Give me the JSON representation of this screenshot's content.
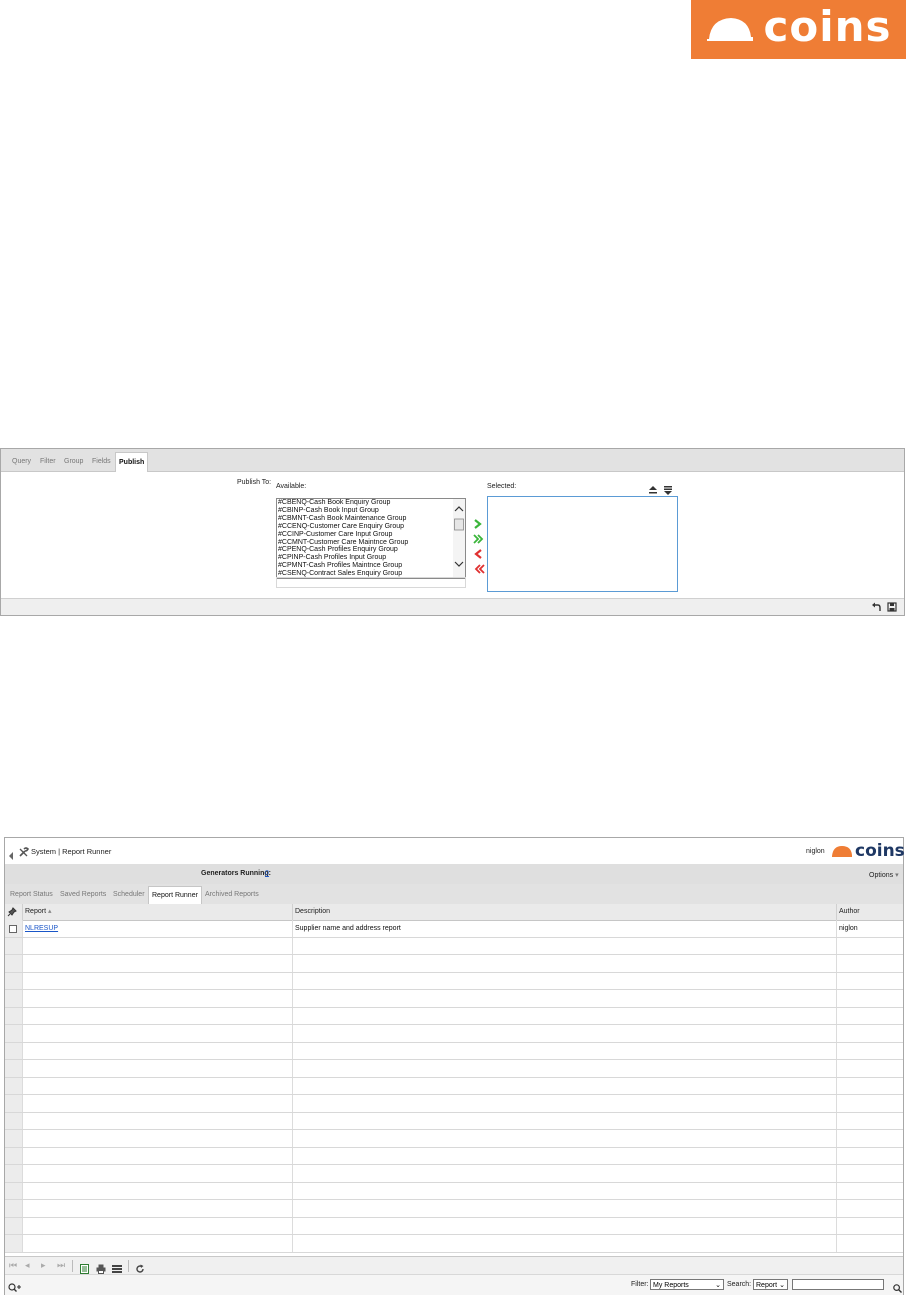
{
  "logo_top": {
    "brand": "coins"
  },
  "publish": {
    "tabs": [
      "Query",
      "Filter",
      "Group",
      "Fields",
      "Publish"
    ],
    "active_tab": "Publish",
    "publish_to_label": "Publish To:",
    "available_label": "Available:",
    "selected_label": "Selected:",
    "available_items": [
      "#CBENQ-Cash Book Enquiry Group",
      "#CBINP-Cash Book Input Group",
      "#CBMNT-Cash Book Maintenance Group",
      "#CCENQ-Customer Care Enquiry Group",
      "#CCINP-Customer Care Input Group",
      "#CCMNT-Customer Care Maintnce Group",
      "#CPENQ-Cash Profiles Enquiry Group",
      "#CPINP-Cash Profiles Input Group",
      "#CPMNT-Cash Profiles Maintnce Group",
      "#CSENQ-Contract Sales Enquiry Group"
    ],
    "selected_items": [],
    "move_icons": [
      "move-right-icon",
      "move-all-right-icon",
      "move-left-icon",
      "move-all-left-icon"
    ],
    "colors": {
      "move_right": "#3ab53a",
      "move_left": "#e03030",
      "list_border_selected": "#5b9bd5"
    }
  },
  "runner": {
    "breadcrumb": "System | Report Runner",
    "user": "niglon",
    "brand": "coins",
    "generators_label": "Generators Running:",
    "generators_count": "0",
    "options_label": "Options",
    "tabs": [
      "Report Status",
      "Saved Reports",
      "Scheduler",
      "Report Runner",
      "Archived Reports"
    ],
    "active_tab": "Report Runner",
    "columns": {
      "report": "Report",
      "description": "Description",
      "author": "Author"
    },
    "rows": [
      {
        "report": "NLRESUP",
        "description": "Supplier name and address report",
        "author": "niglon"
      }
    ],
    "filter_label": "Filter:",
    "filter_value": "My Reports",
    "search_label": "Search:",
    "search_field": "Report",
    "search_value": "",
    "colors": {
      "brand_orange": "#ef7d35",
      "brand_navy": "#1f3864",
      "link": "#1a56c8"
    }
  }
}
